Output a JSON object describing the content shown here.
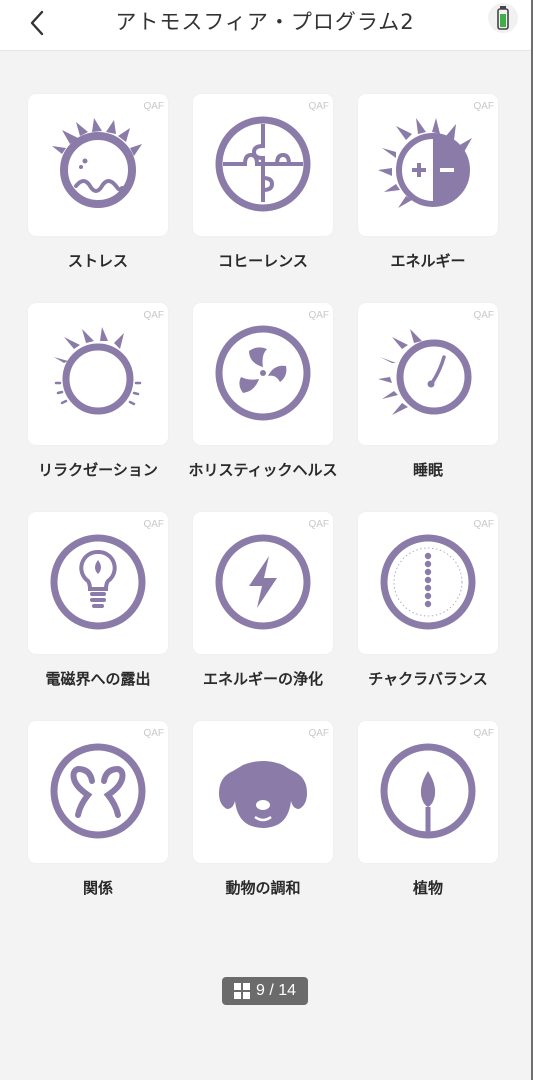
{
  "header": {
    "title": "アトモスフィア・プログラム2",
    "back_icon": "chevron-left-icon",
    "battery_icon": "battery-icon"
  },
  "colors": {
    "icon": "#8b7ba8",
    "background": "#f3f3f3",
    "card": "#ffffff"
  },
  "items": [
    {
      "label": "ストレス",
      "badge": "QAF",
      "icon": "stress-face-icon"
    },
    {
      "label": "コヒーレンス",
      "badge": "QAF",
      "icon": "puzzle-icon"
    },
    {
      "label": "エネルギー",
      "badge": "QAF",
      "icon": "energy-plus-minus-icon"
    },
    {
      "label": "リラクゼーション",
      "badge": "QAF",
      "icon": "relaxation-icon"
    },
    {
      "label": "ホリスティックヘルス",
      "badge": "QAF",
      "icon": "holistic-health-icon"
    },
    {
      "label": "睡眠",
      "badge": "QAF",
      "icon": "sleep-icon"
    },
    {
      "label": "電磁界への露出",
      "badge": "QAF",
      "icon": "light-bulb-icon"
    },
    {
      "label": "エネルギーの浄化",
      "badge": "QAF",
      "icon": "lightning-bolt-icon"
    },
    {
      "label": "チャクラバランス",
      "badge": "QAF",
      "icon": "chakra-icon"
    },
    {
      "label": "関係",
      "badge": "QAF",
      "icon": "relationship-icon"
    },
    {
      "label": "動物の調和",
      "badge": "QAF",
      "icon": "dog-face-icon"
    },
    {
      "label": "植物",
      "badge": "QAF",
      "icon": "leaf-icon"
    }
  ],
  "pager": {
    "text": "9 / 14",
    "icon": "grid-icon"
  }
}
